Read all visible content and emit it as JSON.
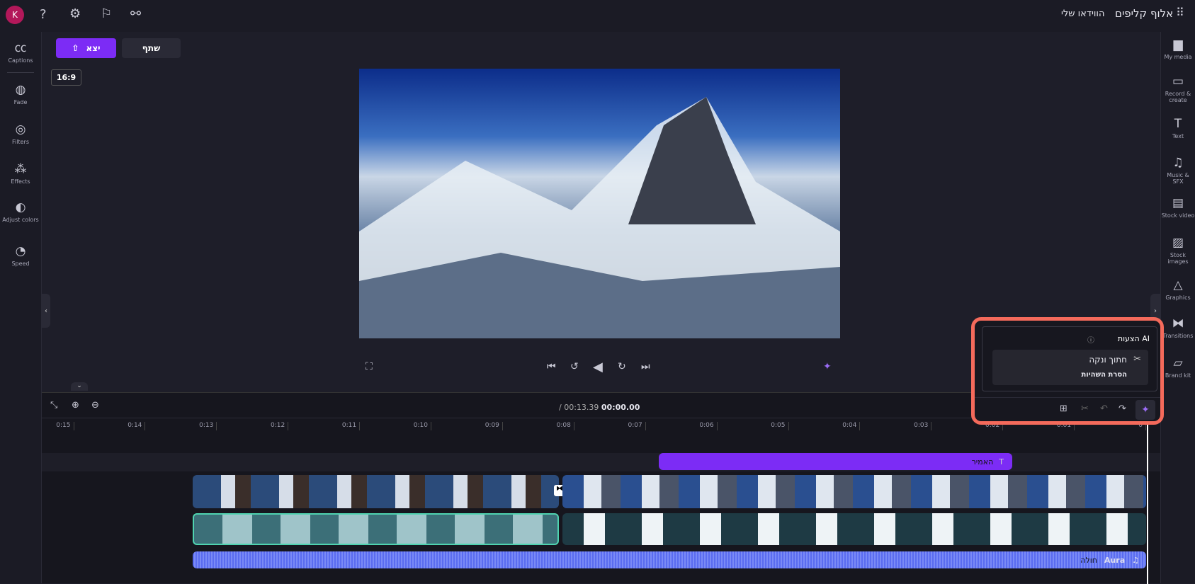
{
  "topbar": {
    "left_icons": [
      "avatar-k",
      "help-icon",
      "gear-icon",
      "feedback-icon",
      "share-team-icon"
    ],
    "avatar_letter": "K",
    "title": "אלוף קליפים",
    "subtitle": "הווידאו שלי",
    "apps_icon": "grid-icon"
  },
  "toolbar": {
    "export_label": "יצא",
    "share_label": "שתף",
    "aspect_ratio": "16:9"
  },
  "left_sidebar": {
    "items": [
      {
        "label": "Captions",
        "icon": "cc"
      },
      {
        "label": "Fade",
        "icon": "fade"
      },
      {
        "label": "Filters",
        "icon": "filters"
      },
      {
        "label": "Effects",
        "icon": "wand"
      },
      {
        "label": "Adjust colors",
        "icon": "contrast"
      },
      {
        "label": "Speed",
        "icon": "gauge"
      }
    ]
  },
  "right_sidebar": {
    "items": [
      {
        "label": "My media",
        "icon": "folder"
      },
      {
        "label": "Record & create",
        "icon": "camera"
      },
      {
        "label": "Text",
        "icon": "T"
      },
      {
        "label": "Music & SFX",
        "icon": "music"
      },
      {
        "label": "Stock video",
        "icon": "film"
      },
      {
        "label": "Stock images",
        "icon": "image"
      },
      {
        "label": "Graphics",
        "icon": "shapes"
      },
      {
        "label": "Transitions",
        "icon": "transition"
      },
      {
        "label": "Brand kit",
        "icon": "brand"
      }
    ]
  },
  "player": {
    "time_current": "00:00.00",
    "time_total": "/ 00:13.39"
  },
  "timeline": {
    "ruler": [
      "0",
      "0:01",
      "0:02",
      "0:03",
      "0:04",
      "0:05",
      "0:06",
      "0:07",
      "0:08",
      "0:09",
      "0:10",
      "0:11",
      "0:12",
      "0:13",
      "0:14",
      "0:15"
    ],
    "text_clip": "האמיר",
    "audio_name": "Aura",
    "audio_label": "חולה"
  },
  "ai_panel": {
    "title": "הצעות AI",
    "suggestion_title": "חתוך ונקה",
    "suggestion_desc": "הסרת השהיות"
  },
  "colors": {
    "accent": "#7c2cf5",
    "highlight": "#f46a5b",
    "audio": "#5a6cf0"
  }
}
